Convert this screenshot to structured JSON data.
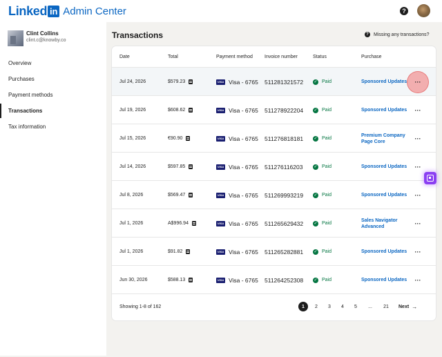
{
  "header": {
    "logo_text": "Linked",
    "logo_box": "in",
    "app_title": "Admin Center",
    "help_glyph": "?"
  },
  "user": {
    "name": "Clint Collins",
    "email": "clint.c@knowby.co"
  },
  "sidebar": {
    "items": [
      {
        "label": "Overview",
        "active": false
      },
      {
        "label": "Purchases",
        "active": false
      },
      {
        "label": "Payment methods",
        "active": false
      },
      {
        "label": "Transactions",
        "active": true
      },
      {
        "label": "Tax information",
        "active": false
      }
    ]
  },
  "main": {
    "title": "Transactions",
    "missing_link": "Missing any transactions?"
  },
  "table": {
    "headers": {
      "date": "Date",
      "total": "Total",
      "payment": "Payment method",
      "invoice": "Invoice number",
      "status": "Status",
      "purchase": "Purchase"
    },
    "card_brand": "VISA",
    "more_glyph": "···",
    "rows": [
      {
        "date": "Jul 24, 2026",
        "total": "$579.23",
        "payment": "Visa - 6765",
        "invoice": "511281321572",
        "status": "Paid",
        "purchase": "Sponsored Updates"
      },
      {
        "date": "Jul 19, 2026",
        "total": "$608.62",
        "payment": "Visa - 6765",
        "invoice": "511278922204",
        "status": "Paid",
        "purchase": "Sponsored Updates"
      },
      {
        "date": "Jul 15, 2026",
        "total": "€90.90",
        "payment": "Visa - 6765",
        "invoice": "511276818181",
        "status": "Paid",
        "purchase": "Premium Company Page Core"
      },
      {
        "date": "Jul 14, 2026",
        "total": "$597.85",
        "payment": "Visa - 6765",
        "invoice": "511276116203",
        "status": "Paid",
        "purchase": "Sponsored Updates"
      },
      {
        "date": "Jul 8, 2026",
        "total": "$569.47",
        "payment": "Visa - 6765",
        "invoice": "511269993219",
        "status": "Paid",
        "purchase": "Sponsored Updates"
      },
      {
        "date": "Jul 1, 2026",
        "total": "A$996.94",
        "payment": "Visa - 6765",
        "invoice": "511265629432",
        "status": "Paid",
        "purchase": "Sales Navigator Advanced"
      },
      {
        "date": "Jul 1, 2026",
        "total": "$91.82",
        "payment": "Visa - 6765",
        "invoice": "511265282881",
        "status": "Paid",
        "purchase": "Sponsored Updates"
      },
      {
        "date": "Jun 30, 2026",
        "total": "$588.13",
        "payment": "Visa - 6765",
        "invoice": "511264252308",
        "status": "Paid",
        "purchase": "Sponsored Updates"
      }
    ]
  },
  "pagination": {
    "showing": "Showing 1-8 of 162",
    "pages": [
      "1",
      "2",
      "3",
      "4",
      "5",
      "...",
      "21"
    ],
    "current": "1",
    "next": "Next"
  },
  "colors": {
    "brand": "#0a66c2",
    "paid": "#057642",
    "highlight": "#f3f6f8",
    "float_button": "#8b3ff2"
  }
}
